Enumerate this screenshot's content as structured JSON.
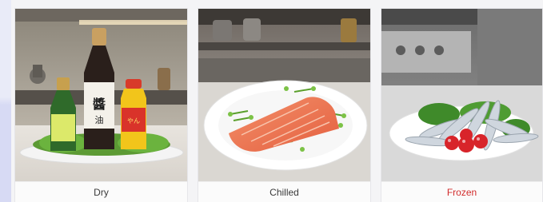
{
  "categories": [
    {
      "label": "Dry",
      "image": "soy-sauce-bottles-on-lettuce-plate"
    },
    {
      "label": "Chilled",
      "image": "salmon-fillet-with-microgreens"
    },
    {
      "label": "Frozen",
      "image": "sardines-with-cherry-tomatoes"
    }
  ],
  "colors": {
    "frozen_label": "#d22c2c",
    "label_text": "#3a3a3a",
    "accent_strip": "#d7daf4"
  }
}
